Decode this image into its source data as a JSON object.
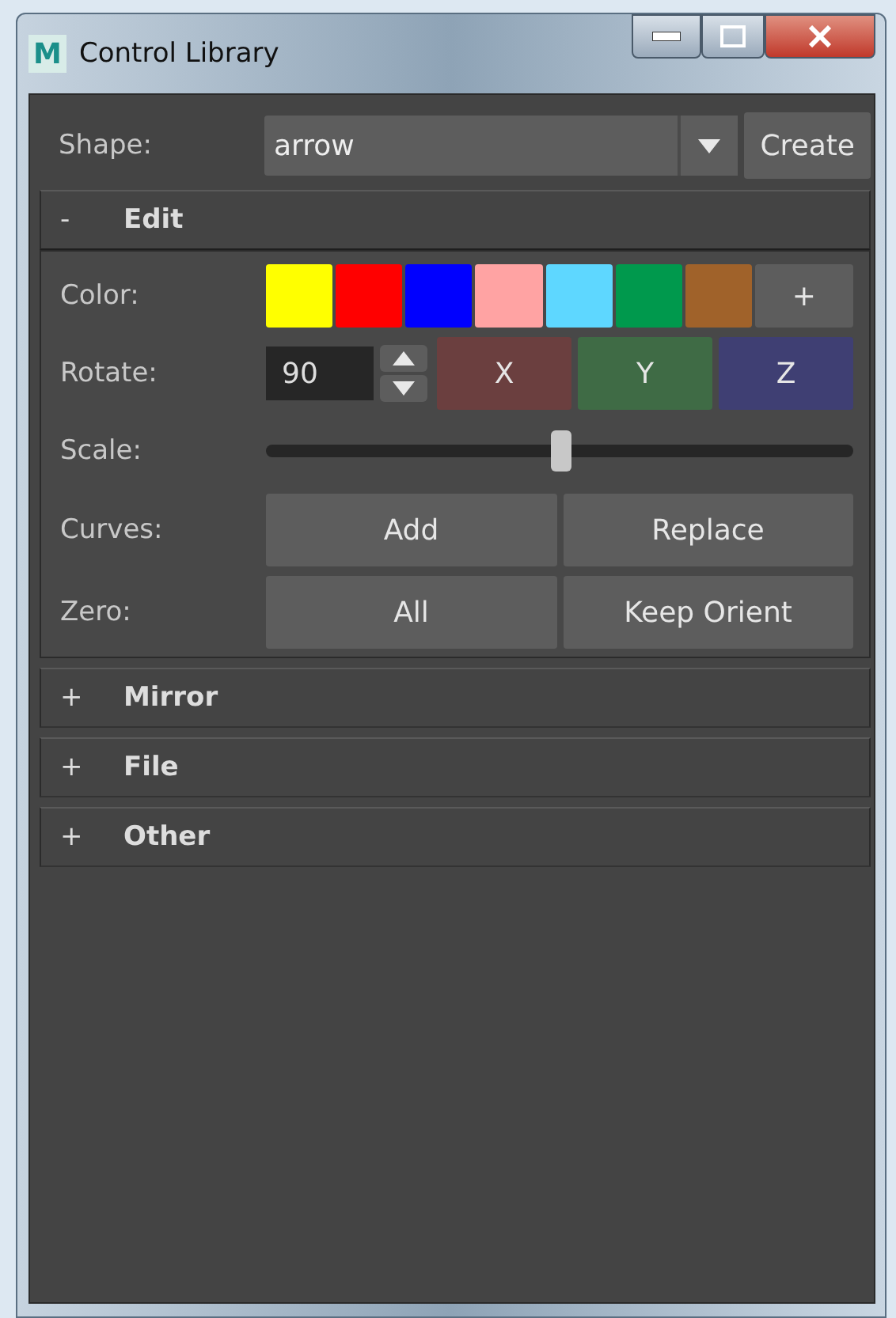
{
  "window": {
    "title": "Control Library",
    "logo": "M"
  },
  "shape": {
    "label": "Shape:",
    "value": "arrow",
    "button": "Create"
  },
  "sections": [
    {
      "title": "Edit",
      "toggle": "-",
      "expanded": true,
      "rows": [
        {
          "kind": "colors",
          "label": "Color:",
          "swatches": [
            {
              "color": "#ffff00"
            },
            {
              "color": "#ff0000"
            },
            {
              "color": "#0000ff"
            },
            {
              "color": "#ffa3a3"
            },
            {
              "color": "#5ed7ff"
            },
            {
              "color": "#00994d"
            },
            {
              "color": "#a0622a"
            }
          ],
          "more": "+"
        },
        {
          "kind": "rotate",
          "label": "Rotate:",
          "value": "90",
          "axes": [
            {
              "label": "X",
              "color": "#6b3f3f"
            },
            {
              "label": "Y",
              "color": "#3f6b45"
            },
            {
              "label": "Z",
              "color": "#3f3f73"
            }
          ]
        },
        {
          "kind": "slider",
          "label": "Scale:",
          "level": 0.5
        },
        {
          "kind": "buttons",
          "label": "Curves:",
          "buttons": [
            "Add",
            "Replace"
          ]
        },
        {
          "kind": "buttons",
          "label": "Zero:",
          "buttons": [
            "All",
            "Keep Orient"
          ]
        }
      ]
    },
    {
      "title": "Mirror",
      "toggle": "+",
      "expanded": false
    },
    {
      "title": "File",
      "toggle": "+",
      "expanded": false
    },
    {
      "title": "Other",
      "toggle": "+",
      "expanded": false
    }
  ]
}
